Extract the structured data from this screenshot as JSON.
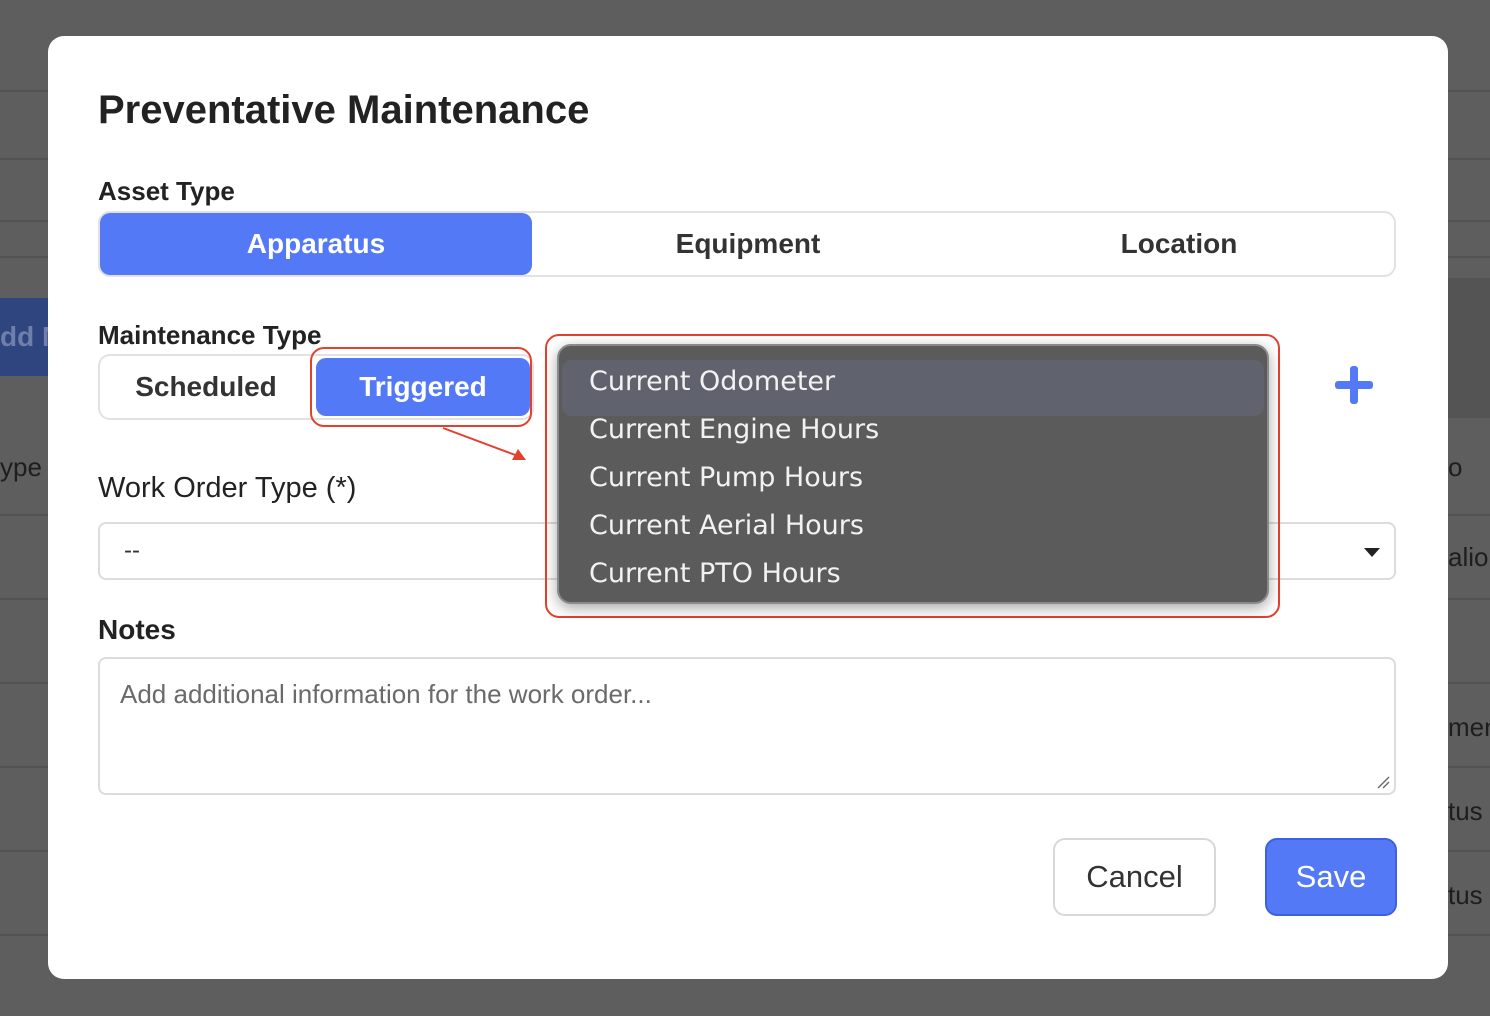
{
  "background": {
    "add_button_label": "dd M",
    "column_fragments": [
      "ype",
      "o",
      "alio",
      "men",
      "tus",
      "tus"
    ]
  },
  "modal": {
    "title": "Preventative Maintenance",
    "asset_type": {
      "label": "Asset Type",
      "options": [
        "Apparatus",
        "Equipment",
        "Location"
      ],
      "selected": "Apparatus"
    },
    "maintenance_type": {
      "label": "Maintenance Type",
      "options": [
        "Scheduled",
        "Triggered"
      ],
      "selected": "Triggered"
    },
    "trigger_dropdown": {
      "options": [
        "Current Odometer",
        "Current Engine Hours",
        "Current Pump Hours",
        "Current Aerial Hours",
        "Current PTO Hours"
      ]
    },
    "work_order_type": {
      "label": "Work Order Type (*)",
      "value": "--"
    },
    "notes": {
      "label": "Notes",
      "placeholder": "Add additional information for the work order..."
    },
    "buttons": {
      "cancel": "Cancel",
      "save": "Save"
    }
  },
  "colors": {
    "accent": "#5479f7",
    "highlight": "#e2412e",
    "overlay": "#5e5e5e"
  }
}
